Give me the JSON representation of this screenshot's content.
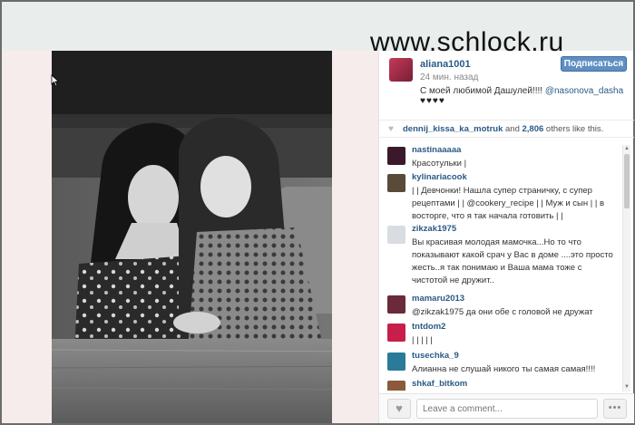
{
  "watermark": "www.schlock.ru",
  "post": {
    "username": "aliana1001",
    "time_ago": "24 мин. назад",
    "follow_label": "Подписаться",
    "caption_text": "С моей любимой Дашулей!!!! ",
    "caption_mention": "@nasonova_dasha",
    "caption_hearts": "♥♥♥♥"
  },
  "likes": {
    "users": "dennij_kissa_ka_motruk",
    "and_text": " and ",
    "count": "2,806",
    "suffix": " others like this."
  },
  "comments": [
    {
      "user": "nastinaaaaa",
      "text": "Красотульки |",
      "avatar_color": "#3a1a2a"
    },
    {
      "user": "kylinariacook",
      "text": "| | Девчонки! Нашла супер страничку, с супер рецептами | | @cookery_recipe | | Муж и сын | | в восторге, что я так начала готовить | |",
      "avatar_color": "#5a4a3a"
    },
    {
      "user": "zikzak1975",
      "text": "Вы красивая молодая мамочка...Но то что показывают какой срач у Вас в доме ....это просто жесть..я так понимаю и Ваша мама тоже с чистотой не дружит..",
      "avatar_color": "#d9dde2"
    },
    {
      "user": "mamaru2013",
      "text": "@zikzak1975 да они обе с головой не дружат",
      "avatar_color": "#6a2a3a"
    },
    {
      "user": "tntdom2",
      "text": "| | | | |",
      "avatar_color": "#c81e4a"
    },
    {
      "user": "tusechka_9",
      "text": "Алианна не слушай никого ты самая самая!!!!",
      "avatar_color": "#2a7a9a"
    },
    {
      "user": "shkaf_bitkom",
      "text": "",
      "avatar_color": "#8a5a3a"
    }
  ],
  "footer": {
    "comment_placeholder": "Leave a comment...",
    "more_label": "•••"
  },
  "colors": {
    "link": "#2a5a86",
    "follow_button": "#5f8fc2",
    "page_background": "#e9eeec",
    "photo_margin": "#f5eceb"
  },
  "icons": {
    "like": "heart-icon",
    "more": "ellipsis-icon",
    "cursor": "pointer-icon"
  }
}
